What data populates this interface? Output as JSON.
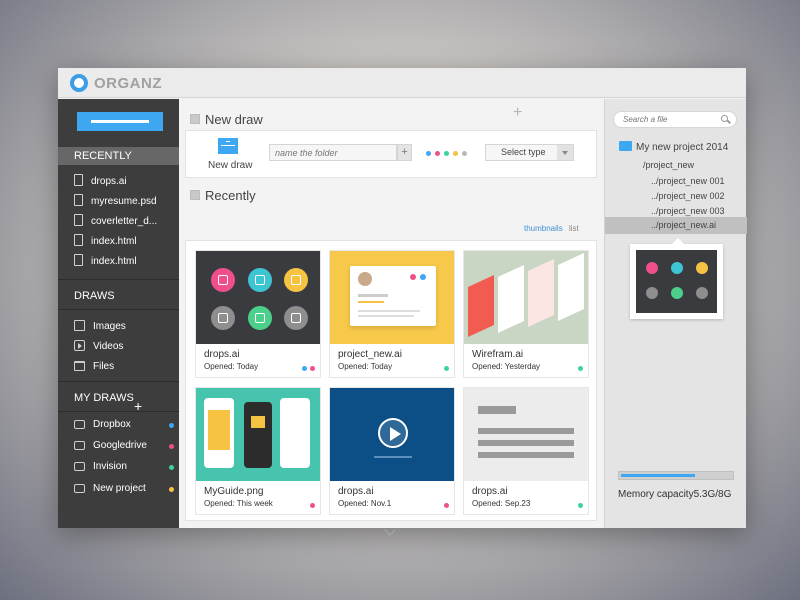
{
  "app": {
    "title": "ORGANZ"
  },
  "sidebar": {
    "recently_header": "RECENTLY",
    "recent_files": [
      "drops.ai",
      "myresume.psd",
      "coverletter_d...",
      "index.html",
      "index.html"
    ],
    "draws_header": "DRAWS",
    "draws": [
      "Images",
      "Videos",
      "Files"
    ],
    "my_draws_header": "MY DRAWS",
    "my_draws": [
      {
        "label": "Dropbox",
        "color": "#3ea7f2"
      },
      {
        "label": "Googledrive",
        "color": "#ef4f8a"
      },
      {
        "label": "Invision",
        "color": "#3ed1a3"
      },
      {
        "label": "New project",
        "color": "#f5c242"
      }
    ]
  },
  "main": {
    "new_draw_title": "New draw",
    "new_draw_button": "New draw",
    "folder_placeholder": "name the folder",
    "select_type": "Select type",
    "color_options": [
      "#3ea7f2",
      "#ef4f8a",
      "#3ed1a3",
      "#f5c242",
      "#b8b8b8"
    ],
    "recently_title": "Recently",
    "view_thumbnails": "thumbnails",
    "view_list": "list",
    "cards": [
      {
        "name": "drops.ai",
        "meta": "Opened: Today",
        "dots": [
          "#3ea7f2",
          "#ef4f8a"
        ]
      },
      {
        "name": "project_new.ai",
        "meta": "Opened: Today",
        "dots": [
          "#3ed1a3"
        ]
      },
      {
        "name": "Wirefram.ai",
        "meta": "Opened: Yesterday",
        "dots": [
          "#3ed1a3"
        ]
      },
      {
        "name": "MyGuide.png",
        "meta": "Opened: This week",
        "dots": [
          "#ef4f8a"
        ]
      },
      {
        "name": "drops.ai",
        "meta": "Opened: Nov.1",
        "dots": [
          "#ef4f8a"
        ]
      },
      {
        "name": "drops.ai",
        "meta": "Opened: Sep.23",
        "dots": [
          "#3ed1a3"
        ]
      }
    ]
  },
  "right": {
    "search_placeholder": "Search a file",
    "tree_root": "My new project 2014",
    "tree": [
      "/project_new",
      "../project_new 001",
      "../project_new 002",
      "../project_new 003",
      "../project_new.ai"
    ],
    "memory_label": "Memory capacity5.3G/8G",
    "memory_fraction": 0.66
  }
}
